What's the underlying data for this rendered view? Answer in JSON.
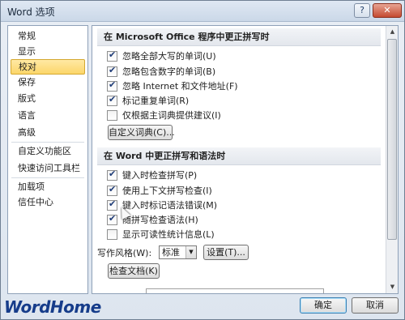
{
  "window": {
    "title": "Word 选项",
    "help_label": "?",
    "close_label": "✕"
  },
  "nav": {
    "items": [
      {
        "label": "常规"
      },
      {
        "label": "显示"
      },
      {
        "label": "校对",
        "active": true
      },
      {
        "label": "保存"
      },
      {
        "label": "版式"
      },
      {
        "label": "语言"
      },
      {
        "label": "高级"
      },
      {
        "label": "自定义功能区"
      },
      {
        "label": "快速访问工具栏"
      },
      {
        "label": "加载项"
      },
      {
        "label": "信任中心"
      }
    ]
  },
  "office_section": {
    "header": "在 Microsoft Office 程序中更正拼写时",
    "options": [
      {
        "label": "忽略全部大写的单词(U)",
        "checked": true
      },
      {
        "label": "忽略包含数字的单词(B)",
        "checked": true
      },
      {
        "label": "忽略 Internet 和文件地址(F)",
        "checked": true
      },
      {
        "label": "标记重复单词(R)",
        "checked": true
      },
      {
        "label": "仅根据主词典提供建议(I)",
        "checked": false
      }
    ],
    "custom_dict_button": "自定义词典(C)..."
  },
  "word_section": {
    "header": "在 Word 中更正拼写和语法时",
    "options": [
      {
        "label": "键入时检查拼写(P)",
        "checked": true
      },
      {
        "label": "使用上下文拼写检查(I)",
        "checked": true
      },
      {
        "label": "键入时标记语法错误(M)",
        "checked": true
      },
      {
        "label": "随拼写检查语法(H)",
        "checked": true
      },
      {
        "label": "显示可读性统计信息(L)",
        "checked": false
      }
    ],
    "writing_style_label": "写作风格(W):",
    "writing_style_value": "标准",
    "settings_button": "设置(T)...",
    "recheck_button": "检查文档(K)"
  },
  "footer": {
    "ok_label": "确定",
    "cancel_label": "取消"
  },
  "watermark": "WordHome",
  "colors": {
    "accent": "#fcd66a",
    "watermark": "#163c8a",
    "close": "#c44a30"
  }
}
